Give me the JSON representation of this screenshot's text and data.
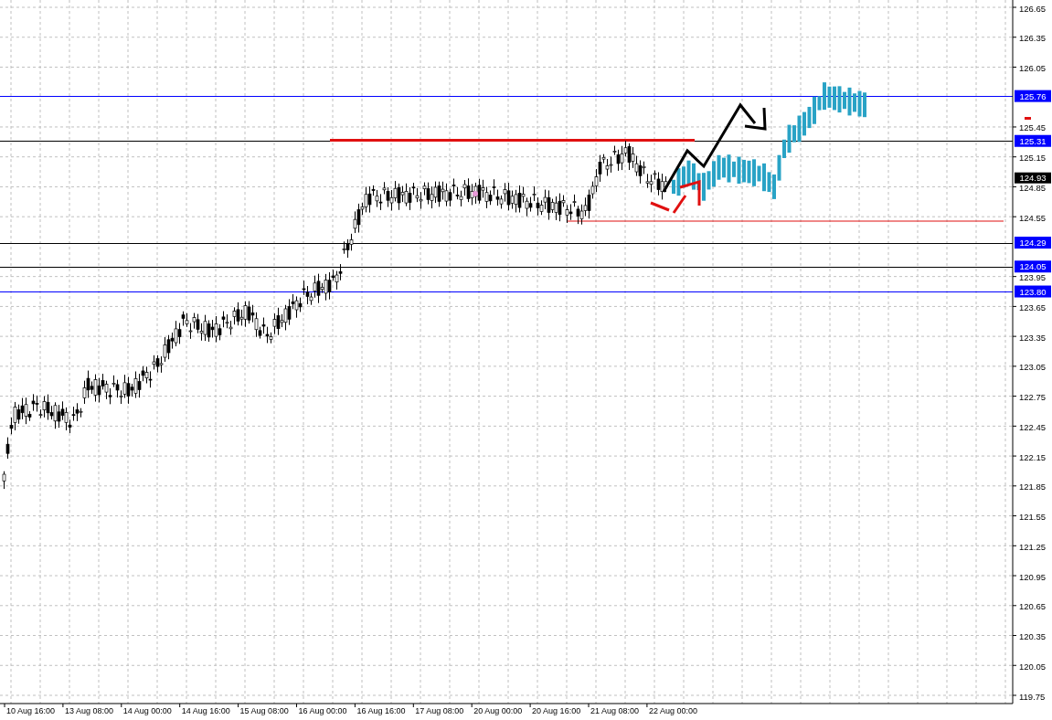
{
  "chart": {
    "price_axis": {
      "ticks": [
        "126.65",
        "126.35",
        "126.05",
        "125.45",
        "125.15",
        "124.85",
        "124.55",
        "123.95",
        "123.65",
        "123.35",
        "123.05",
        "122.75",
        "122.45",
        "122.15",
        "121.85",
        "121.55",
        "121.25",
        "120.95",
        "120.65",
        "120.35",
        "120.05",
        "119.75"
      ]
    },
    "time_axis": {
      "labels": [
        "10 Aug 16:00",
        "13 Aug 08:00",
        "14 Aug 00:00",
        "14 Aug 16:00",
        "15 Aug 08:00",
        "16 Aug 00:00",
        "16 Aug 16:00",
        "17 Aug 08:00",
        "20 Aug 00:00",
        "20 Aug 16:00",
        "21 Aug 08:00",
        "22 Aug 00:00"
      ]
    },
    "price_lines": [
      {
        "label": "125.76",
        "color": "#0000ff"
      },
      {
        "label": "125.31",
        "color": "#000000"
      },
      {
        "label": "124.29",
        "color": "#000000"
      },
      {
        "label": "124.05",
        "color": "#000000"
      },
      {
        "label": "123.80",
        "color": "#0000ff"
      }
    ],
    "current_price": {
      "label": "124.93"
    }
  }
}
